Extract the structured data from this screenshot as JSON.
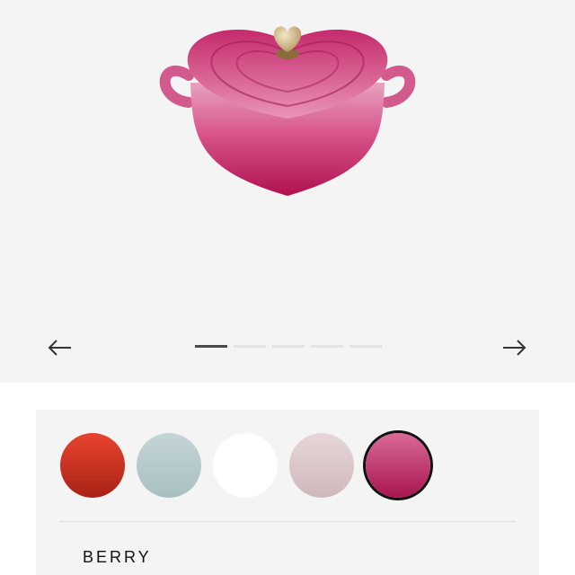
{
  "gallery": {
    "product_image": {
      "icon": "heart-shaped-casserole",
      "color": "#c4286a"
    },
    "prev": {
      "icon": "arrow-left-icon"
    },
    "next": {
      "icon": "arrow-right-icon"
    },
    "slides": {
      "count": 5,
      "active_index": 0
    }
  },
  "colors": {
    "swatches": [
      {
        "color_top": "#e8442e",
        "color_bottom": "#a82215",
        "selected": false
      },
      {
        "color_top": "#c4d5d6",
        "color_bottom": "#a9c0c2",
        "selected": false
      },
      {
        "color_top": "#ffffff",
        "color_bottom": "#ffffff",
        "selected": false
      },
      {
        "color_top": "#e6d6d8",
        "color_bottom": "#cfb8bc",
        "selected": false
      },
      {
        "color_top": "#d96a98",
        "color_bottom": "#a8154f",
        "selected": true
      }
    ],
    "selected_name": "BERRY"
  }
}
